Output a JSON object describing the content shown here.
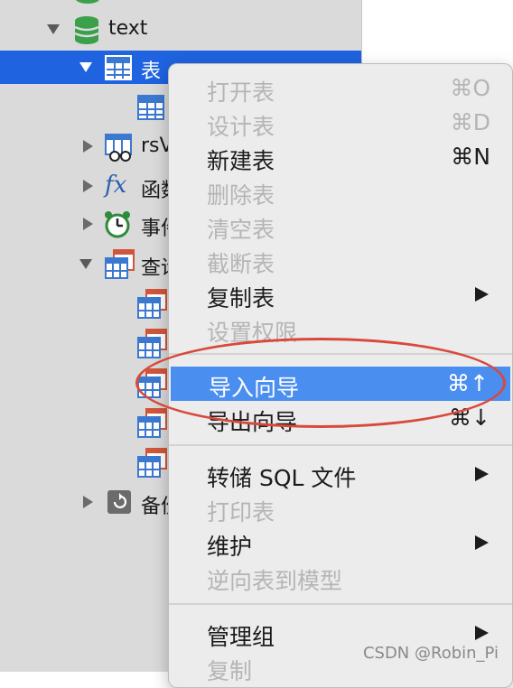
{
  "tree": {
    "db_label": "text",
    "tables_label": "表",
    "views_label": "rsV",
    "functions_label": "函数",
    "events_label": "事件",
    "queries_label": "查询",
    "backups_label": "备份"
  },
  "menu": {
    "items": [
      {
        "label": "打开表",
        "shortcut": "⌘O",
        "enabled": false
      },
      {
        "label": "设计表",
        "shortcut": "⌘D",
        "enabled": false
      },
      {
        "label": "新建表",
        "shortcut": "⌘N",
        "enabled": true
      },
      {
        "label": "删除表",
        "shortcut": "",
        "enabled": false
      },
      {
        "label": "清空表",
        "shortcut": "",
        "enabled": false
      },
      {
        "label": "截断表",
        "shortcut": "",
        "enabled": false
      },
      {
        "label": "复制表",
        "shortcut": "",
        "enabled": true,
        "submenu": true
      },
      {
        "label": "设置权限",
        "shortcut": "",
        "enabled": false
      },
      {
        "label": "导入向导",
        "shortcut": "⌘↑",
        "enabled": true,
        "highlighted": true
      },
      {
        "label": "导出向导",
        "shortcut": "⌘↓",
        "enabled": true
      },
      {
        "label": "转储 SQL 文件",
        "shortcut": "",
        "enabled": true,
        "submenu": true
      },
      {
        "label": "打印表",
        "shortcut": "",
        "enabled": false
      },
      {
        "label": "维护",
        "shortcut": "",
        "enabled": true,
        "submenu": true
      },
      {
        "label": "逆向表到模型",
        "shortcut": "",
        "enabled": false
      },
      {
        "label": "管理组",
        "shortcut": "",
        "enabled": true,
        "submenu": true
      },
      {
        "label": "复制",
        "shortcut": "",
        "enabled": false
      }
    ]
  },
  "watermark": "CSDN @Robin_Pi",
  "colors": {
    "selection": "#1f63e0",
    "menu_highlight": "#4a8ef0",
    "annotation": "#d8493c",
    "table_icon": "#3b78cf"
  }
}
